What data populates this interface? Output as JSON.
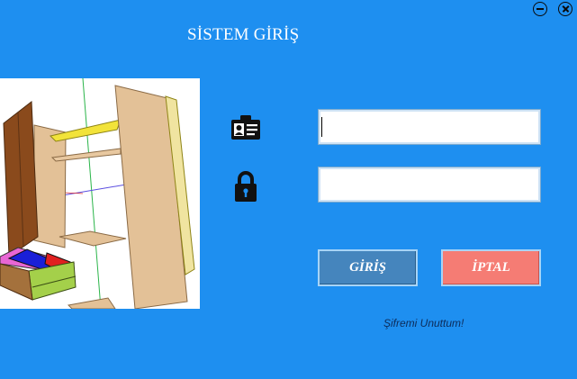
{
  "window": {
    "title": "SİSTEM GİRİŞ",
    "minimize_icon": "minimize-icon",
    "close_icon": "close-icon"
  },
  "login": {
    "username_icon": "id-card-icon",
    "password_icon": "lock-icon",
    "username_value": "",
    "password_value": ""
  },
  "buttons": {
    "login_label": "GİRİŞ",
    "cancel_label": "İPTAL"
  },
  "links": {
    "forgot_password": "Şifremi Unuttum!"
  },
  "colors": {
    "background": "#1e8ff0",
    "login_button": "#4585bd",
    "cancel_button": "#f57c74",
    "link_text": "#0d2c5a"
  }
}
